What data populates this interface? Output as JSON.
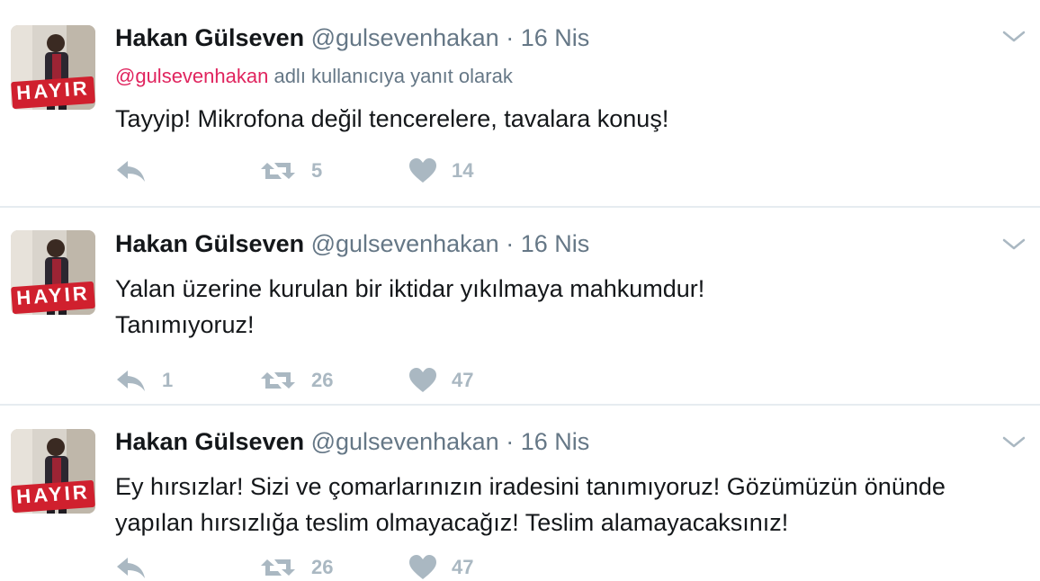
{
  "tweets": [
    {
      "fullname": "Hakan Gülseven",
      "username": "@gulsevenhakan",
      "separator": "·",
      "time": "16 Nis",
      "reply_context": {
        "mention": "@gulsevenhakan",
        "suffix": " adlı kullanıcıya yanıt olarak"
      },
      "text_lines": [
        "Tayyip! Mikrofona değil tencerelere, tavalara konuş!"
      ],
      "reply_count": "",
      "retweet_count": "5",
      "like_count": "14",
      "avatar_badge": "HAYIR"
    },
    {
      "fullname": "Hakan Gülseven",
      "username": "@gulsevenhakan",
      "separator": "·",
      "time": "16 Nis",
      "text_lines": [
        "Yalan üzerine kurulan bir iktidar yıkılmaya mahkumdur!",
        "Tanımıyoruz!"
      ],
      "reply_count": "1",
      "retweet_count": "26",
      "like_count": "47",
      "avatar_badge": "HAYIR"
    },
    {
      "fullname": "Hakan Gülseven",
      "username": "@gulsevenhakan",
      "separator": "·",
      "time": "16 Nis",
      "text_lines": [
        "Ey hırsızlar! Sizi ve çomarlarınızın iradesini tanımıyoruz! Gözümüzün önünde",
        "yapılan hırsızlığa teslim olmayacağız! Teslim alamayacaksınız!"
      ],
      "reply_count": "",
      "retweet_count": "26",
      "like_count": "47",
      "avatar_badge": "HAYIR"
    }
  ],
  "icons": {
    "reply": "reply-icon",
    "retweet": "retweet-icon",
    "like": "heart-icon",
    "caret": "chevron-down-icon"
  },
  "colors": {
    "text": "#14171a",
    "secondary": "#657786",
    "mention": "#e0245e",
    "action_gray": "#aab8c2",
    "badge_red": "#d0202e",
    "divider": "#e6ecf0"
  }
}
